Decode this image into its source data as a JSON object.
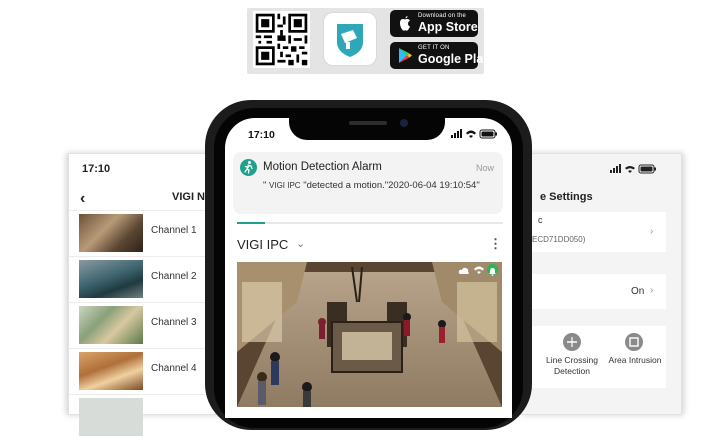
{
  "download": {
    "appstore_sub": "Download on the",
    "appstore_main": "App Store",
    "googleplay_sub": "GET IT ON",
    "googleplay_main": "Google Play"
  },
  "left_phone": {
    "time": "17:10",
    "title": "VIGI N",
    "channels": [
      {
        "label": "Channel 1"
      },
      {
        "label": "Channel 2"
      },
      {
        "label": "Channel 3"
      },
      {
        "label": "Channel 4"
      }
    ]
  },
  "right_phone": {
    "title": "e Settings",
    "row1_letter": "c",
    "row1_detail": "ECD71DD050)",
    "on_value": "On",
    "features": [
      {
        "label": "Line Crossing Detection"
      },
      {
        "label": "Area Intrusion"
      }
    ]
  },
  "center_phone": {
    "time": "17:10",
    "notification": {
      "title": "Motion Detection Alarm",
      "time": "Now",
      "body_prefix": "\" ",
      "body_device": "VIGI IPC",
      "body_rest": " \"detected a motion.\"2020-06-04 19:10:54\""
    },
    "device_title": "VIGI IPC",
    "more": "⋮"
  },
  "colors": {
    "accent": "#21a08b",
    "phone_frame": "#1c1c1c",
    "store_badge": "#111111",
    "strip": "#e4e4e4"
  }
}
